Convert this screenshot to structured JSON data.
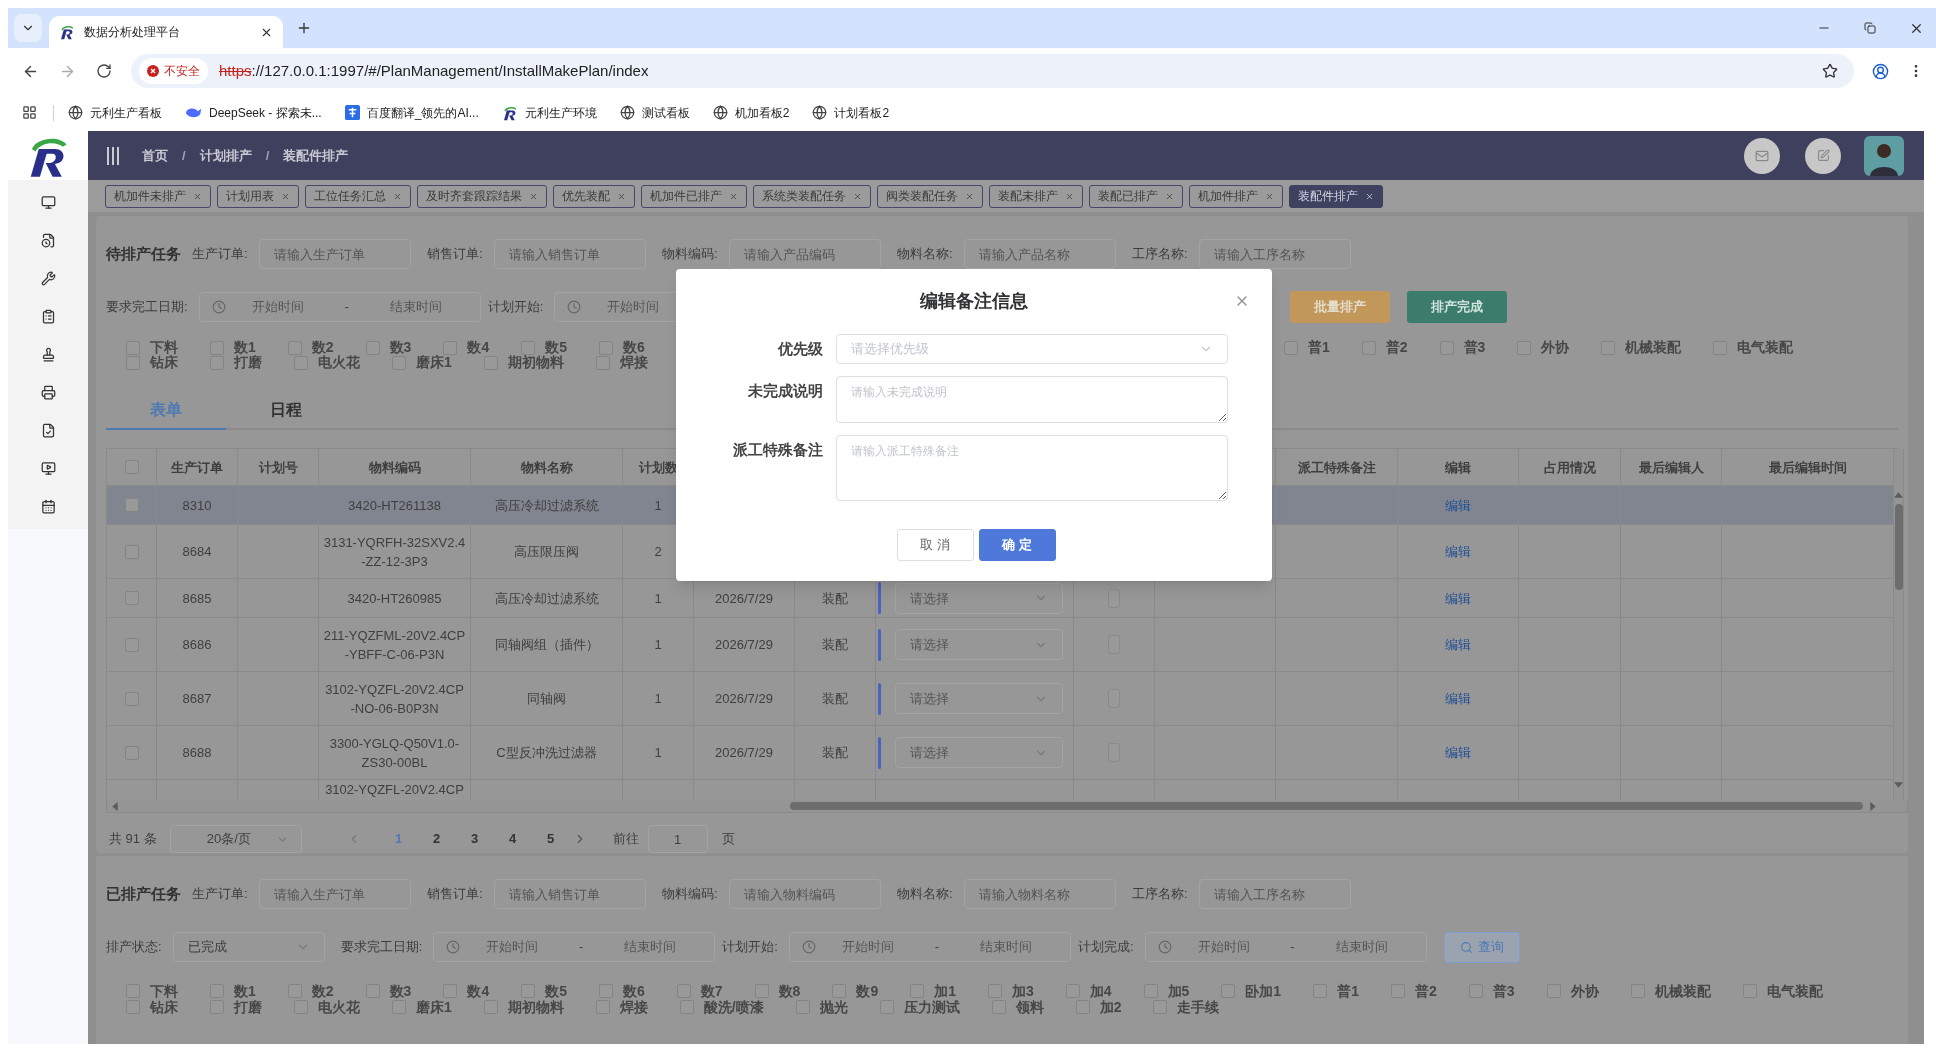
{
  "browser": {
    "tab_title": "数据分析处理平台",
    "security": "不安全",
    "url_scheme": "https",
    "url_rest": "://127.0.0.1:1997/#/PlanManagement/InstallMakePlan/index",
    "bookmarks": [
      {
        "label": "元利生产看板",
        "kind": "globe"
      },
      {
        "label": "DeepSeek - 探索未...",
        "kind": "whale"
      },
      {
        "label": "百度翻译_领先的AI...",
        "kind": "translate"
      },
      {
        "label": "元利生产环境",
        "kind": "logo"
      },
      {
        "label": "测试看板",
        "kind": "globe"
      },
      {
        "label": "机加看板2",
        "kind": "globe"
      },
      {
        "label": "计划看板2",
        "kind": "globe"
      }
    ]
  },
  "breadcrumb": {
    "separator": "/",
    "items": [
      "首页",
      "计划排产",
      "装配件排产"
    ]
  },
  "tags": [
    {
      "label": "机加件未排产",
      "selected": false
    },
    {
      "label": "计划用表",
      "selected": false
    },
    {
      "label": "工位任务汇总",
      "selected": false
    },
    {
      "label": "及时齐套跟踪结果",
      "selected": false
    },
    {
      "label": "优先装配",
      "selected": false
    },
    {
      "label": "机加件已排产",
      "selected": false
    },
    {
      "label": "系统类装配任务",
      "selected": false
    },
    {
      "label": "阀类装配任务",
      "selected": false
    },
    {
      "label": "装配未排产",
      "selected": false
    },
    {
      "label": "装配已排产",
      "selected": false
    },
    {
      "label": "机加件排产",
      "selected": false
    },
    {
      "label": "装配件排产",
      "selected": true
    }
  ],
  "pending": {
    "title": "待排产任务",
    "filters": [
      {
        "label": "生产订单:",
        "placeholder": "请输入生产订单"
      },
      {
        "label": "销售订单:",
        "placeholder": "请输入销售订单"
      },
      {
        "label": "物料编码:",
        "placeholder": "请输入产品编码"
      },
      {
        "label": "物料名称:",
        "placeholder": "请输入产品名称"
      },
      {
        "label": "工序名称:",
        "placeholder": "请输入工序名称"
      }
    ],
    "date_filters": [
      {
        "label": "要求完工日期:",
        "start": "开始时间",
        "separator": "-",
        "end": "结束时间"
      },
      {
        "label": "计划开始:",
        "start": "开始时间"
      }
    ],
    "actions": [
      {
        "label": "批量排产",
        "kind": "warning"
      },
      {
        "label": "排产完成",
        "kind": "success"
      }
    ],
    "checks_row1_left": [
      {
        "label": "下料",
        "checked": false
      },
      {
        "label": "数1",
        "checked": false
      },
      {
        "label": "数2",
        "checked": false
      },
      {
        "label": "数3",
        "checked": false
      },
      {
        "label": "数4",
        "checked": false
      },
      {
        "label": "数5",
        "checked": false
      },
      {
        "label": "数6",
        "checked": false
      }
    ],
    "checks_row1_right": [
      {
        "label": "普1",
        "checked": false
      },
      {
        "label": "普2",
        "checked": false
      },
      {
        "label": "普3",
        "checked": false
      },
      {
        "label": "外协",
        "checked": false
      },
      {
        "label": "机械装配",
        "checked": false
      },
      {
        "label": "电气装配",
        "checked": false
      }
    ],
    "checks_row2_left": [
      {
        "label": "钻床",
        "checked": false
      },
      {
        "label": "打磨",
        "checked": false
      },
      {
        "label": "电火花",
        "checked": false
      },
      {
        "label": "磨床1",
        "checked": false
      },
      {
        "label": "期初物料",
        "checked": false
      },
      {
        "label": "焊接",
        "checked": false
      }
    ],
    "tabs": [
      {
        "label": "表单",
        "selected": true
      },
      {
        "label": "日程",
        "selected": false
      }
    ],
    "table": {
      "header_checked": false,
      "columns_left": [
        "生产订单",
        "计划号",
        "物料编码",
        "物料名称",
        "计划数"
      ],
      "columns_right": [
        "派工特殊备注",
        "编辑",
        "占用情况",
        "最后编辑人",
        "最后编辑时间"
      ],
      "rows": [
        {
          "kind": "row",
          "selected": true,
          "checked": false,
          "order": "8310",
          "code": [
            "3420-HT261138"
          ],
          "name": "高压冷却过滤系统",
          "qty": "1",
          "edit": "编辑"
        },
        {
          "kind": "row",
          "selected": false,
          "checked": false,
          "order": "8684",
          "code": [
            "3131-YQRFH-32SXV2.4",
            "-ZZ-12-3P3"
          ],
          "name": "高压限压阀",
          "qty": "2",
          "edit": "编辑"
        },
        {
          "kind": "row",
          "selected": false,
          "checked": false,
          "order": "8685",
          "code": [
            "3420-HT260985"
          ],
          "name": "高压冷却过滤系统",
          "qty": "1",
          "date": "2026/7/29",
          "process": "装配",
          "select": "请选择",
          "done": false,
          "edit": "编辑"
        },
        {
          "kind": "row",
          "selected": false,
          "checked": false,
          "order": "8686",
          "code": [
            "211-YQZFML-20V2.4CP",
            "-YBFF-C-06-P3N"
          ],
          "name": "同轴阀组（插件）",
          "qty": "1",
          "date": "2026/7/29",
          "process": "装配",
          "select": "请选择",
          "done": false,
          "edit": "编辑"
        },
        {
          "kind": "row",
          "selected": false,
          "checked": false,
          "order": "8687",
          "code": [
            "3102-YQZFL-20V2.4CP",
            "-NO-06-B0P3N"
          ],
          "name": "同轴阀",
          "qty": "1",
          "date": "2026/7/29",
          "process": "装配",
          "select": "请选择",
          "done": false,
          "edit": "编辑"
        },
        {
          "kind": "row",
          "selected": false,
          "checked": false,
          "order": "8688",
          "code": [
            "3300-YGLQ-Q50V1.0-",
            "ZS30-00BL"
          ],
          "name": "C型反冲洗过滤器",
          "qty": "1",
          "date": "2026/7/29",
          "process": "装配",
          "select": "请选择",
          "done": false,
          "edit": "编辑"
        },
        {
          "kind": "partial",
          "selected": false,
          "code": [
            "3102-YQZFL-20V2.4CP"
          ]
        }
      ]
    },
    "pagination": {
      "total": "共 91 条",
      "page_size": "20条/页",
      "pages": [
        {
          "label": "1",
          "selected": true
        },
        {
          "label": "2",
          "selected": false
        },
        {
          "label": "3",
          "selected": false
        },
        {
          "label": "4",
          "selected": false
        },
        {
          "label": "5",
          "selected": false
        }
      ],
      "goto_label": "前往",
      "goto_value": "1",
      "page_unit": "页"
    }
  },
  "scheduled": {
    "title": "已排产任务",
    "filters": [
      {
        "label": "生产订单:",
        "placeholder": "请输入生产订单"
      },
      {
        "label": "销售订单:",
        "placeholder": "请输入销售订单"
      },
      {
        "label": "物料编码:",
        "placeholder": "请输入物料编码"
      },
      {
        "label": "物料名称:",
        "placeholder": "请输入物料名称"
      },
      {
        "label": "工序名称:",
        "placeholder": "请输入工序名称"
      }
    ],
    "status": {
      "label": "排产状态:",
      "value": "已完成"
    },
    "date_filters": [
      {
        "label": "要求完工日期:",
        "start": "开始时间",
        "separator": "-",
        "end": "结束时间"
      },
      {
        "label": "计划开始:",
        "start": "开始时间",
        "separator": "-",
        "end": "结束时间"
      },
      {
        "label": "计划完成:",
        "start": "开始时间",
        "separator": "-",
        "end": "结束时间"
      }
    ],
    "search": "查询",
    "checks_row1": [
      {
        "label": "下料",
        "checked": false
      },
      {
        "label": "数1",
        "checked": false
      },
      {
        "label": "数2",
        "checked": false
      },
      {
        "label": "数3",
        "checked": false
      },
      {
        "label": "数4",
        "checked": false
      },
      {
        "label": "数5",
        "checked": false
      },
      {
        "label": "数6",
        "checked": false
      },
      {
        "label": "数7",
        "checked": false
      },
      {
        "label": "数8",
        "checked": false
      },
      {
        "label": "数9",
        "checked": false
      },
      {
        "label": "加1",
        "checked": false
      },
      {
        "label": "加3",
        "checked": false
      },
      {
        "label": "加4",
        "checked": false
      },
      {
        "label": "加5",
        "checked": false
      },
      {
        "label": "卧加1",
        "checked": false
      },
      {
        "label": "普1",
        "checked": false
      },
      {
        "label": "普2",
        "checked": false
      },
      {
        "label": "普3",
        "checked": false
      },
      {
        "label": "外协",
        "checked": false
      },
      {
        "label": "机械装配",
        "checked": false
      },
      {
        "label": "电气装配",
        "checked": false
      }
    ],
    "checks_row2": [
      {
        "label": "钻床",
        "checked": false
      },
      {
        "label": "打磨",
        "checked": false
      },
      {
        "label": "电火花",
        "checked": false
      },
      {
        "label": "磨床1",
        "checked": false
      },
      {
        "label": "期初物料",
        "checked": false
      },
      {
        "label": "焊接",
        "checked": false
      },
      {
        "label": "酸洗/喷漆",
        "checked": false
      },
      {
        "label": "抛光",
        "checked": false
      },
      {
        "label": "压力测试",
        "checked": false
      },
      {
        "label": "领料",
        "checked": false
      },
      {
        "label": "加2",
        "checked": false
      },
      {
        "label": "走手续",
        "checked": false
      }
    ]
  },
  "dialog": {
    "title": "编辑备注信息",
    "fields": [
      {
        "label": "优先级",
        "kind": "select",
        "placeholder": "请选择优先级"
      },
      {
        "label": "未完成说明",
        "kind": "textarea",
        "placeholder": "请输入未完成说明"
      },
      {
        "label": "派工特殊备注",
        "kind": "textarea_tall",
        "placeholder": "请输入派工特殊备注"
      }
    ],
    "buttons": [
      {
        "label": "取 消",
        "kind": "default"
      },
      {
        "label": "确 定",
        "kind": "primary"
      }
    ]
  }
}
